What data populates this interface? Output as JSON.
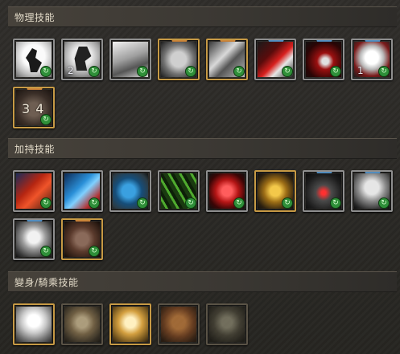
{
  "sections": {
    "physical": {
      "title": "物理技能",
      "skills": [
        {
          "id": "phys-1",
          "label": "",
          "frame": "gray"
        },
        {
          "id": "phys-2",
          "label": "2",
          "frame": "gray"
        },
        {
          "id": "phys-3",
          "label": "",
          "frame": "gray"
        },
        {
          "id": "phys-4",
          "label": "",
          "frame": "gold"
        },
        {
          "id": "phys-5",
          "label": "",
          "frame": "gold"
        },
        {
          "id": "phys-6",
          "label": "",
          "frame": "gray"
        },
        {
          "id": "phys-7",
          "label": "",
          "frame": "gray"
        },
        {
          "id": "phys-8",
          "label": "1",
          "frame": "gray"
        },
        {
          "id": "phys-9",
          "label": "3 4",
          "frame": "gold"
        }
      ]
    },
    "buff": {
      "title": "加持技能",
      "skills": [
        {
          "id": "buff-1",
          "label": "",
          "frame": "gray"
        },
        {
          "id": "buff-2",
          "label": "",
          "frame": "gray"
        },
        {
          "id": "buff-3",
          "label": "",
          "frame": "gray"
        },
        {
          "id": "buff-4",
          "label": "",
          "frame": "gray"
        },
        {
          "id": "buff-5",
          "label": "",
          "frame": "gray"
        },
        {
          "id": "buff-6",
          "label": "",
          "frame": "gold"
        },
        {
          "id": "buff-7",
          "label": "",
          "frame": "gray"
        },
        {
          "id": "buff-8",
          "label": "",
          "frame": "gray"
        },
        {
          "id": "buff-9",
          "label": "",
          "frame": "gray"
        },
        {
          "id": "buff-10",
          "label": "",
          "frame": "gold"
        }
      ]
    },
    "transform": {
      "title": "變身/騎乘技能",
      "skills": [
        {
          "id": "trans-1",
          "label": "",
          "frame": "gold"
        },
        {
          "id": "trans-2",
          "label": "",
          "frame": "dim"
        },
        {
          "id": "trans-3",
          "label": "",
          "frame": "gold"
        },
        {
          "id": "trans-4",
          "label": "",
          "frame": "dim"
        },
        {
          "id": "trans-5",
          "label": "",
          "frame": "dim"
        },
        {
          "id": "trans-6",
          "label": "",
          "frame": "dim"
        }
      ]
    }
  },
  "colors": {
    "frame_gray": "#8f8f8f",
    "frame_gold": "#c79a45",
    "badge_green": "#2f8f39",
    "header_text": "#e2dac8"
  },
  "icons": {
    "refresh": "refresh-icon"
  }
}
